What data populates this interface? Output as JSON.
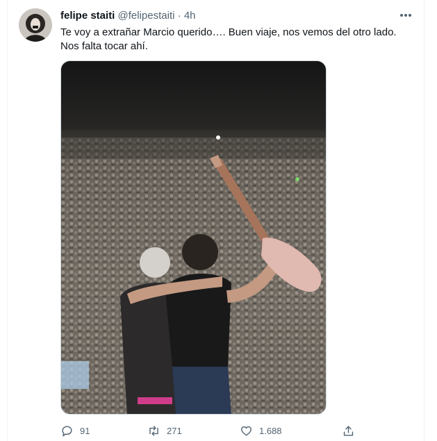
{
  "tweet": {
    "author_name": "felipe staiti",
    "author_handle": "@felipestaiti",
    "separator": "·",
    "time": "4h",
    "text_line1": "Te voy a extrañar Marcio querido…. Buen viaje, nos vemos del otro lado.",
    "text_line2": "Nos falta tocar ahí."
  },
  "actions": {
    "replies": "91",
    "retweets": "271",
    "likes": "1.688"
  },
  "icons": {
    "more": "more-icon",
    "reply": "reply-icon",
    "retweet": "retweet-icon",
    "like": "heart-icon",
    "share": "share-icon"
  },
  "colors": {
    "text": "#0f1419",
    "secondary": "#536471",
    "border": "#cfd9de"
  }
}
